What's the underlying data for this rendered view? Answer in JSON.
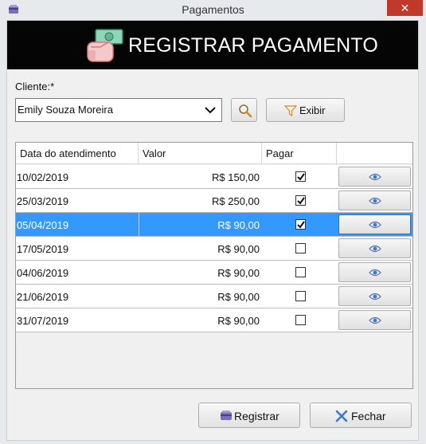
{
  "window": {
    "title": "Pagamentos",
    "close_glyph": "✕"
  },
  "banner": {
    "title": "REGISTRAR PAGAMENTO",
    "icon": "money-hand-icon"
  },
  "form": {
    "cliente_label": "Cliente:*",
    "cliente_value": "Emily Souza Moreira",
    "exibir_label": "Exibir"
  },
  "table": {
    "columns": [
      "Data do atendimento",
      "Valor",
      "Pagar",
      ""
    ],
    "rows": [
      {
        "date": "10/02/2019",
        "valor": "R$ 150,00",
        "pagar": true
      },
      {
        "date": "25/03/2019",
        "valor": "R$ 250,00",
        "pagar": true
      },
      {
        "date": "05/04/2019",
        "valor": "R$ 90,00",
        "pagar": true,
        "selected": true
      },
      {
        "date": "17/05/2019",
        "valor": "R$ 90,00",
        "pagar": false
      },
      {
        "date": "04/06/2019",
        "valor": "R$ 90,00",
        "pagar": false
      },
      {
        "date": "21/06/2019",
        "valor": "R$ 90,00",
        "pagar": false
      },
      {
        "date": "31/07/2019",
        "valor": "R$ 90,00",
        "pagar": false
      }
    ]
  },
  "footer": {
    "registrar_label": "Registrar",
    "fechar_label": "Fechar"
  },
  "colors": {
    "selection": "#3399ff",
    "banner_bg": "#050505",
    "close_bg": "#c0392b",
    "fechar_x": "#3b78c8"
  }
}
